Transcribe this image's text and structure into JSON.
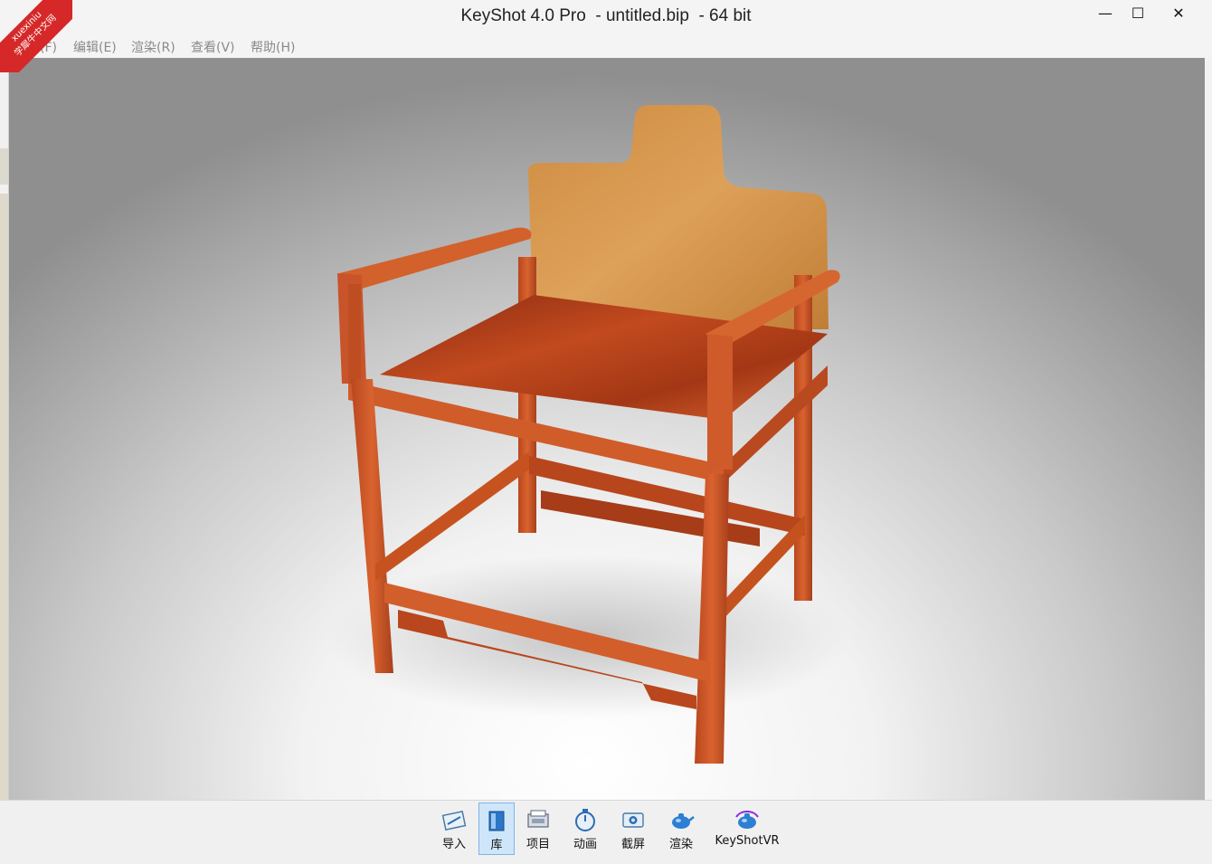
{
  "window": {
    "title": "KeyShot 4.0 Pro  - untitled.bip  - 64 bit",
    "min_icon": "minimize-icon",
    "max_icon": "maximize-icon",
    "close_icon": "close-icon",
    "min_glyph": "—",
    "max_glyph": "☐",
    "close_glyph": "✕"
  },
  "watermark": {
    "line1": "xuexiniu",
    "line2": "学犀牛中文网"
  },
  "menu": {
    "items": [
      {
        "label": "文件(F)"
      },
      {
        "label": "编辑(E)"
      },
      {
        "label": "渲染(R)"
      },
      {
        "label": "查看(V)"
      },
      {
        "label": "帮助(H)"
      }
    ]
  },
  "toolbar": {
    "items": [
      {
        "label": "导入",
        "icon": "import-icon",
        "active": false
      },
      {
        "label": "库",
        "icon": "library-icon",
        "active": true
      },
      {
        "label": "项目",
        "icon": "project-icon",
        "active": false
      },
      {
        "label": "动画",
        "icon": "animation-icon",
        "active": false
      },
      {
        "label": "截屏",
        "icon": "screenshot-icon",
        "active": false
      },
      {
        "label": "渲染",
        "icon": "render-icon",
        "active": false
      },
      {
        "label": "KeyShotVR",
        "icon": "keyshotvr-icon",
        "active": false
      }
    ]
  },
  "colors": {
    "accent": "#7eb4ea",
    "wood": "#c9592c",
    "wood_light": "#d9914a",
    "badge": "#d62828"
  }
}
